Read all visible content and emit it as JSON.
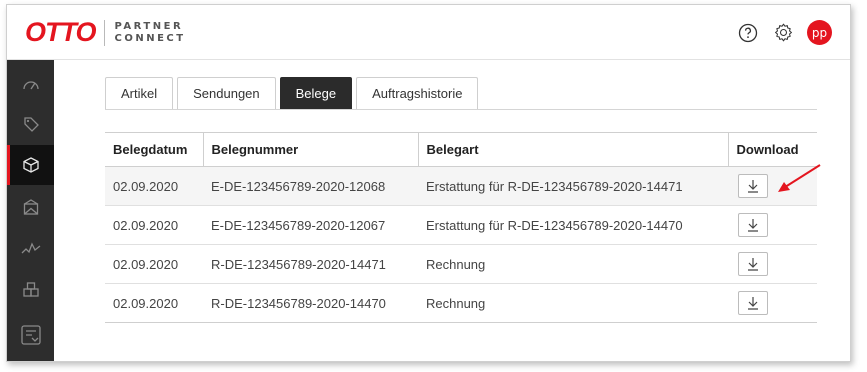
{
  "header": {
    "logo_text": "OTTO",
    "product_line1": "PARTNER",
    "product_line2": "CONNECT",
    "help_icon": "help-circle-icon",
    "settings_icon": "gear-icon",
    "avatar_initials": "pp"
  },
  "sidebar": {
    "items": [
      {
        "icon": "gauge-icon",
        "active": false
      },
      {
        "icon": "tag-icon",
        "active": false
      },
      {
        "icon": "box-icon",
        "active": true
      },
      {
        "icon": "envelope-icon",
        "active": false
      },
      {
        "icon": "chart-line-icon",
        "active": false
      },
      {
        "icon": "boxes-icon",
        "active": false
      },
      {
        "icon": "document-exchange-icon",
        "active": false
      }
    ]
  },
  "tabs": [
    {
      "label": "Artikel",
      "active": false
    },
    {
      "label": "Sendungen",
      "active": false
    },
    {
      "label": "Belege",
      "active": true
    },
    {
      "label": "Auftragshistorie",
      "active": false
    }
  ],
  "table": {
    "columns": [
      "Belegdatum",
      "Belegnummer",
      "Belegart",
      "Download"
    ],
    "rows": [
      {
        "date": "02.09.2020",
        "number": "E-DE-123456789-2020-12068",
        "type": "Erstattung für R-DE-123456789-2020-14471",
        "highlighted": true
      },
      {
        "date": "02.09.2020",
        "number": "E-DE-123456789-2020-12067",
        "type": "Erstattung für R-DE-123456789-2020-14470",
        "highlighted": false
      },
      {
        "date": "02.09.2020",
        "number": "R-DE-123456789-2020-14471",
        "type": "Rechnung",
        "highlighted": false
      },
      {
        "date": "02.09.2020",
        "number": "R-DE-123456789-2020-14470",
        "type": "Rechnung",
        "highlighted": false
      }
    ],
    "download_icon": "download-icon"
  },
  "annotation": {
    "color": "#e4151f"
  },
  "colors": {
    "brand": "#e4151f",
    "sidebar": "#2d2d2d",
    "active_tab": "#2b2b2b"
  }
}
